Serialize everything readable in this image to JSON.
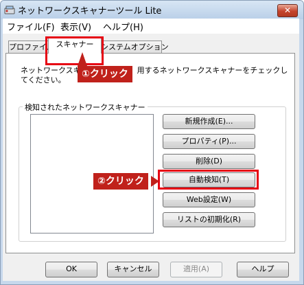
{
  "window": {
    "title": "ネットワークスキャナーツール Lite",
    "close_glyph": "✕"
  },
  "menu": [
    {
      "label": "ファイル(F)"
    },
    {
      "label": "表示(V)"
    },
    {
      "label": "ヘルプ(H)"
    }
  ],
  "tabs": [
    {
      "label": "プロファイル"
    },
    {
      "label": "スキャナー"
    },
    {
      "label": "システムオプション"
    }
  ],
  "scanner_tab": {
    "description_line1": "ネットワークスキャナ",
    "description_line1_rest": "用するネットワークスキャナーをチェックし",
    "description_line2": "てください。",
    "group_label": "検知されたネットワークスキャナー",
    "buttons": [
      {
        "label": "新規作成(E)..."
      },
      {
        "label": "プロパティ(P)..."
      },
      {
        "label": "削除(D)"
      },
      {
        "label": "自動検知(T)"
      },
      {
        "label": "Web設定(W)"
      },
      {
        "label": "リストの初期化(R)"
      }
    ]
  },
  "bottom_buttons": {
    "ok": "OK",
    "cancel": "キャンセル",
    "apply": "適用(A)",
    "help": "ヘルプ"
  },
  "annotations": {
    "step1": "①クリック",
    "step2": "②クリック"
  },
  "colors": {
    "callout": "#c0211b",
    "highlight": "#e60012"
  }
}
